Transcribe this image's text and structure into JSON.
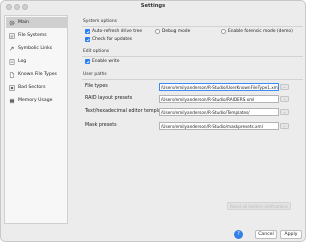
{
  "window": {
    "title": "Settings"
  },
  "sidebar": {
    "items": [
      {
        "label": "Main",
        "icon": "gear-icon",
        "selected": true
      },
      {
        "label": "File Systems",
        "icon": "file-systems-icon",
        "selected": false
      },
      {
        "label": "Symbolic Links",
        "icon": "symbolic-link-icon",
        "selected": false
      },
      {
        "label": "Log",
        "icon": "log-icon",
        "selected": false
      },
      {
        "label": "Known File Types",
        "icon": "file-types-icon",
        "selected": false
      },
      {
        "label": "Bad Sectors",
        "icon": "bad-sectors-icon",
        "selected": false
      },
      {
        "label": "Memory Usage",
        "icon": "memory-icon",
        "selected": false
      }
    ]
  },
  "system_options": {
    "heading": "System options",
    "auto_refresh": {
      "label": "Auto-refresh drive tree",
      "checked": true
    },
    "debug_mode": {
      "label": "Debug mode",
      "checked": false
    },
    "forensic_mode": {
      "label": "Enable forensic mode (demo)",
      "checked": false
    },
    "check_updates": {
      "label": "Check for updates",
      "checked": true
    }
  },
  "edit_options": {
    "heading": "Edit options",
    "enable_write": {
      "label": "Enable write",
      "checked": true
    }
  },
  "user_paths": {
    "heading": "User paths",
    "rows": [
      {
        "label": "File types",
        "value": "/Users/emilyanderson/R-Studio/UserKnownFileType1.xml",
        "browse": "..."
      },
      {
        "label": "RAID layout presets",
        "value": "/Users/emilyanderson/R-Studio/RAIDERS.xml",
        "browse": "..."
      },
      {
        "label": "Text/hexadecimal editor templates",
        "value": "/Users/emilyanderson/R-Studio/Templates/",
        "browse": "..."
      },
      {
        "label": "Mask presets",
        "value": "/Users/emilyanderson/R-Studio/maskpresets.xml",
        "browse": "..."
      }
    ]
  },
  "buttons": {
    "reset": "Reset all hidden notifications",
    "help": "?",
    "cancel": "Cancel",
    "apply": "Apply"
  }
}
